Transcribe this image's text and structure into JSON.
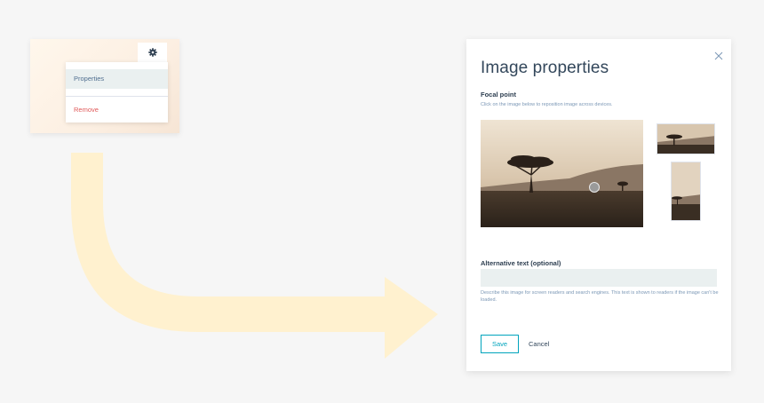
{
  "context_menu": {
    "gear_icon": "gear-icon",
    "items": [
      {
        "label": "Properties"
      },
      {
        "label": "Remove"
      }
    ]
  },
  "modal": {
    "title": "Image properties",
    "focal_point": {
      "label": "Focal point",
      "helper": "Click on the image below to reposition image across devices."
    },
    "alt_text": {
      "label": "Alternative text (optional)",
      "value": "",
      "helper": "Describe this image for screen readers and search engines. This text is shown to readers if the image can't be loaded."
    },
    "buttons": {
      "save": "Save",
      "cancel": "Cancel"
    }
  },
  "colors": {
    "accent": "#00a4bd",
    "danger": "#e05a5a",
    "arrow": "#fff1cf",
    "text": "#33475b"
  }
}
